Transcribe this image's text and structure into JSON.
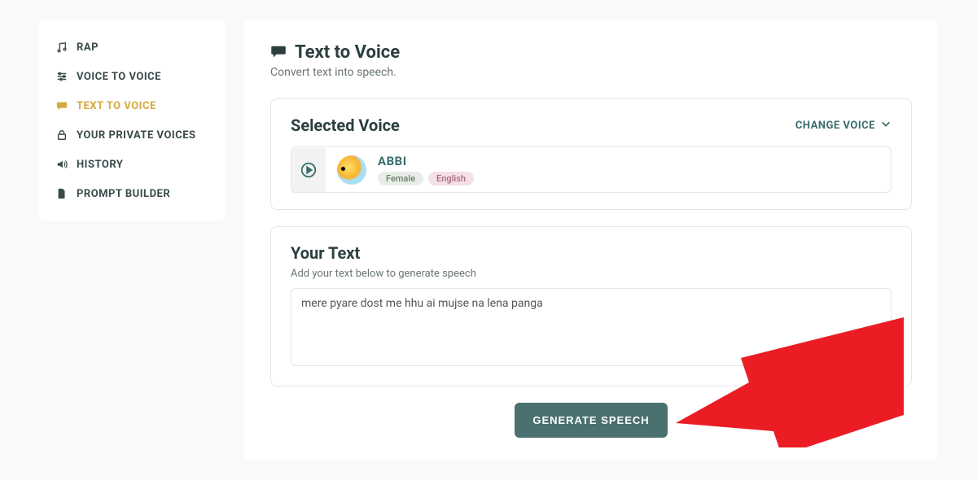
{
  "sidebar": {
    "items": [
      {
        "label": "RAP",
        "icon": "music"
      },
      {
        "label": "VOICE TO VOICE",
        "icon": "sliders"
      },
      {
        "label": "TEXT TO VOICE",
        "icon": "chat"
      },
      {
        "label": "YOUR PRIVATE VOICES",
        "icon": "lock"
      },
      {
        "label": "HISTORY",
        "icon": "volume"
      },
      {
        "label": "PROMPT BUILDER",
        "icon": "file"
      }
    ],
    "activeIndex": 2
  },
  "header": {
    "title": "Text to Voice",
    "subtitle": "Convert text into speech."
  },
  "selectedVoice": {
    "cardTitle": "Selected Voice",
    "changeLabel": "CHANGE VOICE",
    "voice": {
      "name": "ABBI",
      "tags": [
        "Female",
        "English"
      ]
    }
  },
  "yourText": {
    "cardTitle": "Your Text",
    "help": "Add your text below to generate speech",
    "value": "mere pyare dost me hhu ai mujse na lena panga"
  },
  "generateLabel": "GENERATE SPEECH"
}
